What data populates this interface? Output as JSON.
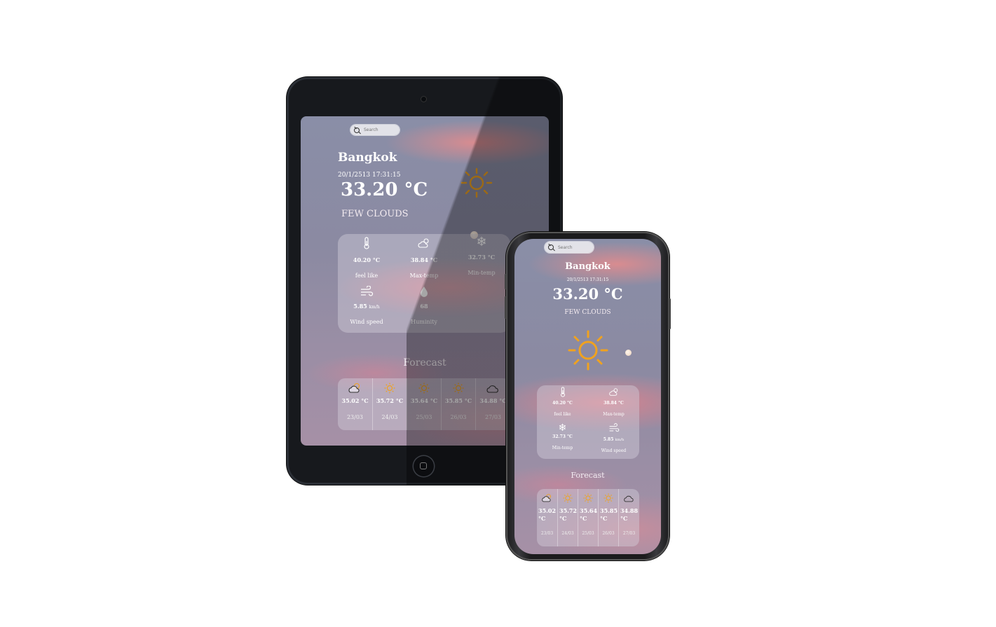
{
  "colors": {
    "sun": "#f0a21f",
    "sky_top": "#8a8ea7",
    "cloud": "#e0828c"
  },
  "search": {
    "placeholder": "Search"
  },
  "weather": {
    "city": "Bangkok",
    "datetime": "20/1/2513 17:31:15",
    "temp": "33.20 °C",
    "condition": "FEW CLOUDS",
    "details": {
      "feel_like": {
        "value": "40.20 °C",
        "label": "feel like",
        "icon": "thermometer-icon"
      },
      "max_temp": {
        "value": "38.84 °C",
        "label": "Max-temp",
        "icon": "cloud-sun-icon"
      },
      "min_temp": {
        "value": "32.73 °C",
        "label": "Min-temp",
        "icon": "snowflake-icon"
      },
      "wind": {
        "value": "5.85",
        "unit": "km/h",
        "label": "Wind speed",
        "icon": "wind-icon"
      },
      "humidity": {
        "value": "68",
        "label": "Huminity",
        "icon": "drop-icon"
      }
    },
    "forecast_title": "Forecast",
    "forecast": [
      {
        "icon": "cloud-sun-icon",
        "temp": "35.02 °C",
        "date": "23/03"
      },
      {
        "icon": "sun-icon",
        "temp": "35.72 °C",
        "date": "24/03"
      },
      {
        "icon": "sun-icon",
        "temp": "35.64 °C",
        "date": "25/03"
      },
      {
        "icon": "sun-icon",
        "temp": "35.85 °C",
        "date": "26/03"
      },
      {
        "icon": "cloud-icon",
        "temp": "34.88 °C",
        "date": "27/03"
      }
    ]
  }
}
